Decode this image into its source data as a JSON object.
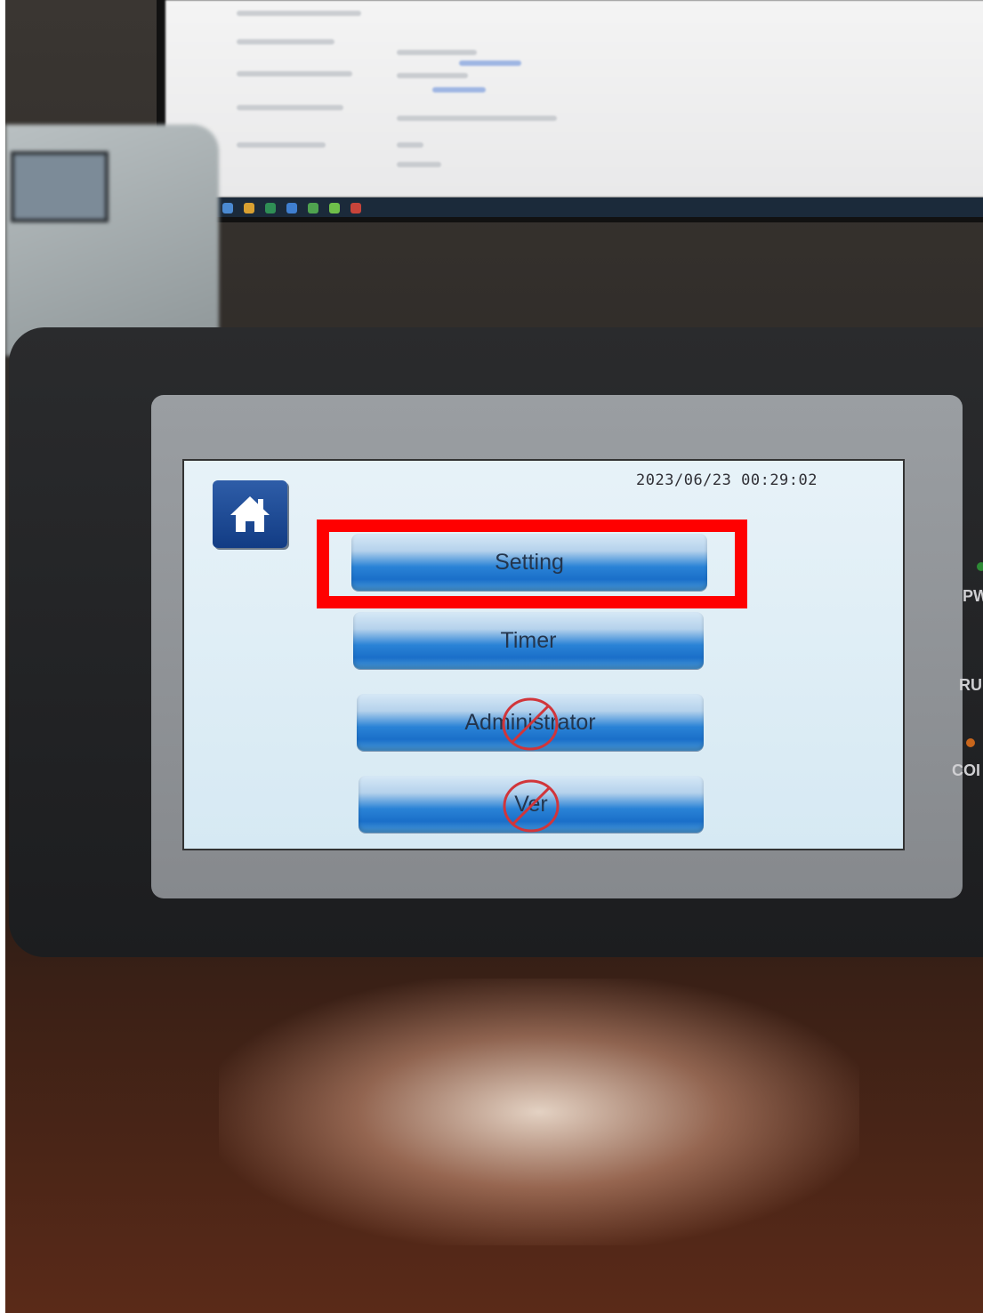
{
  "screen": {
    "datetime": "2023/06/23 00:29:02",
    "home_button": {
      "icon": "home-icon"
    },
    "menu": [
      {
        "label": "Setting",
        "locked": false
      },
      {
        "label": "Timer",
        "locked": false
      },
      {
        "label": "Administrator",
        "locked": true
      },
      {
        "label": "Ver",
        "locked": true
      }
    ]
  },
  "side_panel": {
    "labels": [
      "PW",
      "RU",
      "COI"
    ]
  },
  "highlight": {
    "target": "Setting",
    "color": "#ff0000"
  }
}
